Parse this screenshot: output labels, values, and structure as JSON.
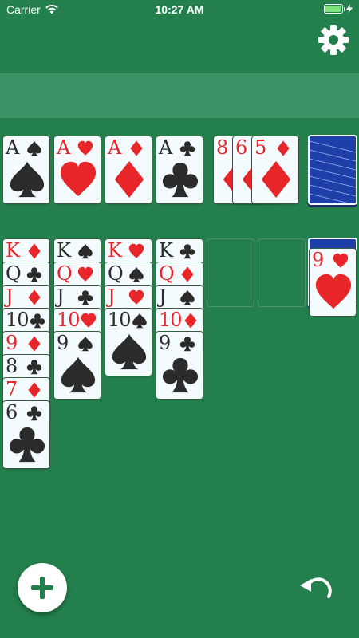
{
  "status_bar": {
    "carrier": "Carrier",
    "time": "10:27 AM",
    "battery_level": 0.95
  },
  "icons": {
    "settings": "gear-icon",
    "new_game": "plus-icon",
    "undo": "undo-icon",
    "wifi": "wifi-icon",
    "charging": "bolt-icon"
  },
  "colors": {
    "table": "#23804c",
    "banner": "#3a9366",
    "red_suit": "#e8262a",
    "black_suit": "#2b2b2b",
    "card_back": "#1f3fa8",
    "fab_plus": "#23804c"
  },
  "foundations": [
    {
      "rank": "A",
      "suit": "spades"
    },
    {
      "rank": "A",
      "suit": "hearts"
    },
    {
      "rank": "A",
      "suit": "diamonds"
    },
    {
      "rank": "A",
      "suit": "clubs"
    }
  ],
  "waste": [
    {
      "rank": "8",
      "suit": "diamonds"
    },
    {
      "rank": "6",
      "suit": "diamonds"
    },
    {
      "rank": "5",
      "suit": "diamonds"
    }
  ],
  "stock": {
    "face_down": true
  },
  "tableau": [
    [
      {
        "rank": "K",
        "suit": "diamonds"
      },
      {
        "rank": "Q",
        "suit": "clubs"
      },
      {
        "rank": "J",
        "suit": "diamonds"
      },
      {
        "rank": "10",
        "suit": "clubs"
      },
      {
        "rank": "9",
        "suit": "diamonds"
      },
      {
        "rank": "8",
        "suit": "clubs"
      },
      {
        "rank": "7",
        "suit": "diamonds"
      },
      {
        "rank": "6",
        "suit": "clubs"
      }
    ],
    [
      {
        "rank": "K",
        "suit": "spades"
      },
      {
        "rank": "Q",
        "suit": "hearts"
      },
      {
        "rank": "J",
        "suit": "clubs"
      },
      {
        "rank": "10",
        "suit": "hearts"
      },
      {
        "rank": "9",
        "suit": "spades"
      }
    ],
    [
      {
        "rank": "K",
        "suit": "hearts"
      },
      {
        "rank": "Q",
        "suit": "spades"
      },
      {
        "rank": "J",
        "suit": "hearts"
      },
      {
        "rank": "10",
        "suit": "spades"
      }
    ],
    [
      {
        "rank": "K",
        "suit": "clubs"
      },
      {
        "rank": "Q",
        "suit": "diamonds"
      },
      {
        "rank": "J",
        "suit": "spades"
      },
      {
        "rank": "10",
        "suit": "diamonds"
      },
      {
        "rank": "9",
        "suit": "clubs"
      }
    ],
    [],
    [],
    [
      {
        "face_down": true
      },
      {
        "rank": "9",
        "suit": "hearts"
      }
    ]
  ]
}
